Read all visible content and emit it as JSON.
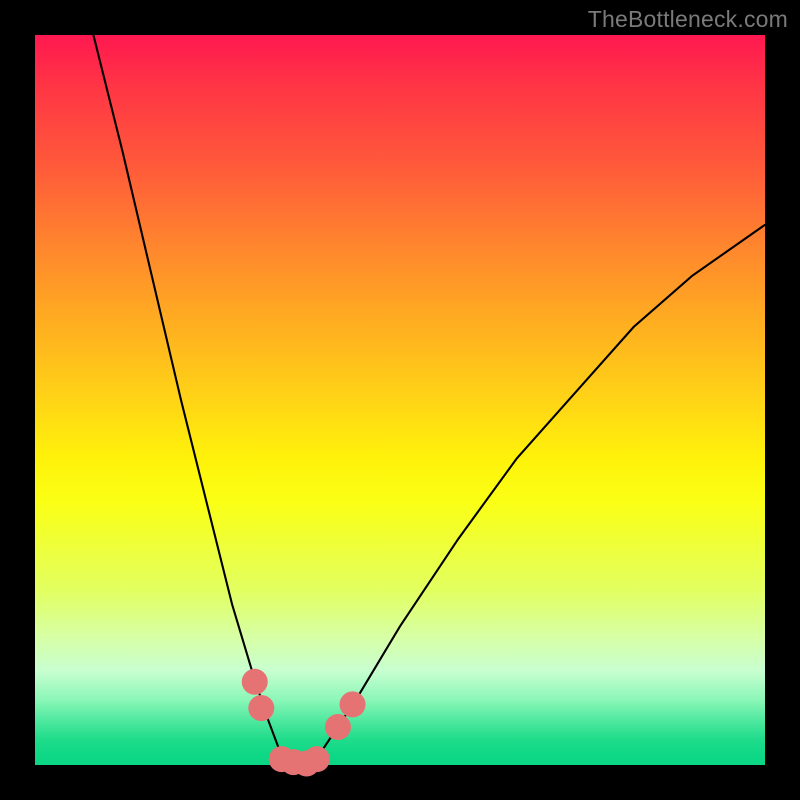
{
  "watermark": {
    "text": "TheBottleneck.com"
  },
  "chart_data": {
    "type": "line",
    "title": "",
    "xlabel": "",
    "ylabel": "",
    "xlim": [
      0,
      100
    ],
    "ylim": [
      0,
      100
    ],
    "background_gradient": {
      "direction": "vertical",
      "top_color": "#ff1850",
      "mid_color": "#fff20a",
      "bottom_color": "#0ad684",
      "note": "Red at top through orange/yellow to green at bottom; no axis ticks or labels shown."
    },
    "series": [
      {
        "name": "left-curve",
        "note": "Steep descending curve from top-left into the valley near x≈33, y≈0.",
        "x": [
          8,
          12,
          16,
          20,
          24,
          27,
          30,
          32,
          33.5,
          34.5
        ],
        "y": [
          100,
          84,
          67,
          50,
          34,
          22,
          12,
          6,
          2,
          0
        ]
      },
      {
        "name": "right-curve",
        "note": "Ascending curve from the valley toward the right edge near y≈74.",
        "x": [
          38,
          40,
          44,
          50,
          58,
          66,
          74,
          82,
          90,
          100
        ],
        "y": [
          0,
          3,
          9,
          19,
          31,
          42,
          51,
          60,
          67,
          74
        ]
      },
      {
        "name": "valley-floor",
        "note": "Short flat segment at y≈0 between the two curves.",
        "x": [
          34.5,
          38
        ],
        "y": [
          0,
          0
        ]
      }
    ],
    "markers": [
      {
        "name": "left-marker-upper",
        "x": 30.1,
        "y": 11.4,
        "color": "#e57373",
        "radius_px": 13
      },
      {
        "name": "left-marker-lower",
        "x": 31.0,
        "y": 7.8,
        "color": "#e57373",
        "radius_px": 13
      },
      {
        "name": "valley-marker-1",
        "x": 33.8,
        "y": 0.8,
        "color": "#e57373",
        "radius_px": 13
      },
      {
        "name": "valley-marker-2",
        "x": 35.4,
        "y": 0.4,
        "color": "#e57373",
        "radius_px": 13
      },
      {
        "name": "valley-marker-3",
        "x": 37.2,
        "y": 0.2,
        "color": "#e57373",
        "radius_px": 13
      },
      {
        "name": "valley-marker-4",
        "x": 38.6,
        "y": 0.8,
        "color": "#e57373",
        "radius_px": 13
      },
      {
        "name": "right-marker-lower",
        "x": 41.5,
        "y": 5.2,
        "color": "#e57373",
        "radius_px": 13
      },
      {
        "name": "right-marker-upper",
        "x": 43.5,
        "y": 8.3,
        "color": "#e57373",
        "radius_px": 13
      }
    ]
  }
}
